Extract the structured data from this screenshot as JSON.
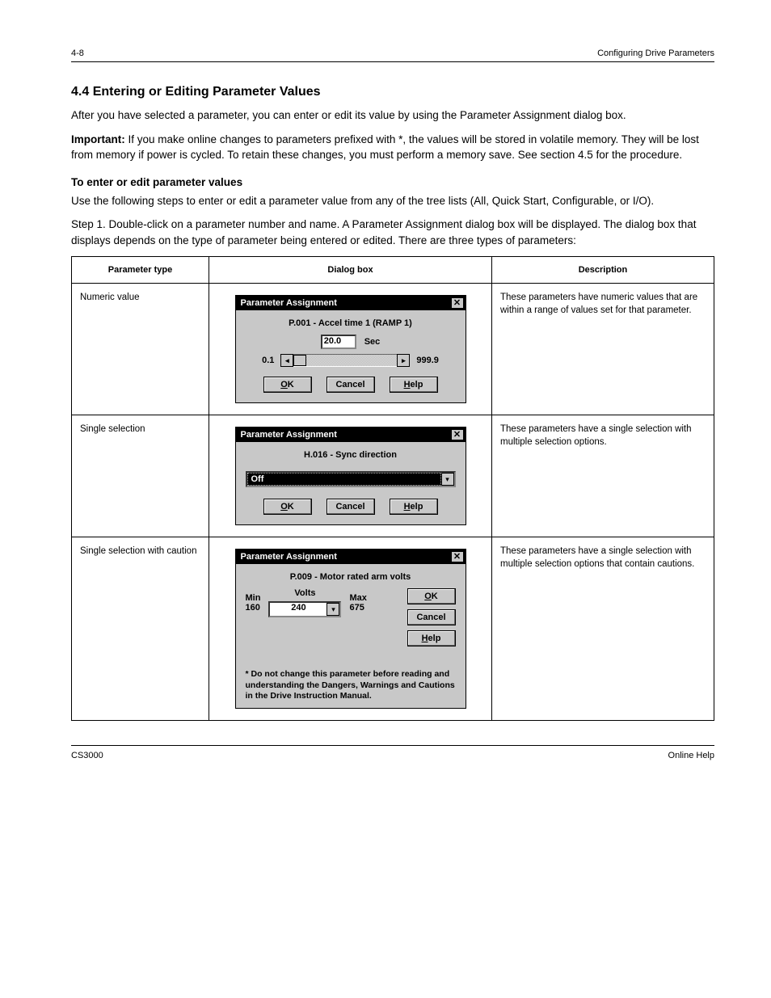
{
  "header": {
    "left": "4-8",
    "right": "Configuring Drive Parameters"
  },
  "intro": {
    "title": "4.4  Entering or Editing Parameter Values",
    "p1": "After you have selected a parameter, you can enter or edit its value by using the Parameter Assignment dialog box.",
    "p2_prefix": "Important:",
    "p2": " If you make online changes to parameters prefixed with *, the values will be stored in volatile memory. They will be lost from memory if power is cycled. To retain these changes, you must perform a memory save. See section 4.5 for the procedure.",
    "sub": "To enter or edit parameter values",
    "steps": "Use the following steps to enter or edit a parameter value from any of the tree lists (All, Quick Start, Configurable, or I/O).",
    "step1": "Step 1. Double-click on a parameter number and name. A Parameter Assignment dialog box will be displayed. The dialog box that displays depends on the type of parameter being entered or edited. There are three types of parameters:"
  },
  "table": {
    "headers": [
      "Parameter type",
      "Dialog box",
      "Description"
    ],
    "rows": [
      {
        "type": "Numeric value",
        "desc": "These parameters have numeric values that are within a range of values set for that parameter."
      },
      {
        "type": "Single selection",
        "desc": "These parameters have a single selection with multiple selection options."
      },
      {
        "type": "Single selection with caution",
        "desc": "These parameters have a single selection with multiple selection options that contain cautions."
      }
    ]
  },
  "dlg1": {
    "title": "Parameter Assignment",
    "param": "P.001 - Accel time 1 (RAMP 1)",
    "value": "20.0",
    "unit": "Sec",
    "min": "0.1",
    "max": "999.9",
    "ok": "OK",
    "cancel": "Cancel",
    "help": "Help"
  },
  "dlg2": {
    "title": "Parameter Assignment",
    "param": "H.016 - Sync direction",
    "value": "Off",
    "ok": "OK",
    "cancel": "Cancel",
    "help": "Help"
  },
  "dlg3": {
    "title": "Parameter Assignment",
    "param": "P.009 - Motor rated arm volts",
    "volts": "Volts",
    "min_label": "Min",
    "min": "160",
    "max_label": "Max",
    "max": "675",
    "value": "240",
    "ok": "OK",
    "cancel": "Cancel",
    "help": "Help",
    "warn": "* Do not change this parameter before reading and understanding the Dangers, Warnings and Cautions in the Drive Instruction Manual."
  },
  "footer": {
    "left": "CS3000",
    "right": "Online Help"
  }
}
